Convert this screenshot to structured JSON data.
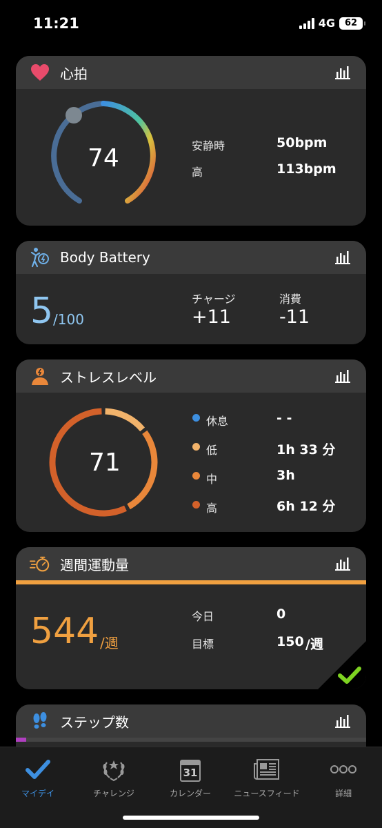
{
  "status_bar": {
    "time": "11:21",
    "network": "4G",
    "battery": "62"
  },
  "colors": {
    "accent_blue": "#3d8fe0",
    "weekly_orange": "#f0a040",
    "check_green": "#7ed321",
    "steps_purple": "#b03fc0"
  },
  "heart_rate": {
    "title": "心拍",
    "icon": "heart-icon",
    "current": "74",
    "current_fraction": 0.05,
    "rows": [
      {
        "label": "安静時",
        "value": "50bpm"
      },
      {
        "label": "高",
        "value": "113bpm"
      }
    ]
  },
  "body_battery": {
    "title": "Body Battery",
    "icon": "body-battery-icon",
    "level": "5",
    "max": "/100",
    "charge_label": "チャージ",
    "charge_value": "+11",
    "drain_label": "消費",
    "drain_value": "-11"
  },
  "stress": {
    "title": "ストレスレベル",
    "icon": "stress-person-icon",
    "level": "71",
    "rows": [
      {
        "label": "休息",
        "value": "- -",
        "color": "#3d8fe0"
      },
      {
        "label": "低",
        "value": "1h 33 分",
        "color": "#f2b36b"
      },
      {
        "label": "中",
        "value": "3h",
        "color": "#e9873a"
      },
      {
        "label": "高",
        "value": "6h 12 分",
        "color": "#d3612a"
      }
    ],
    "segments": [
      {
        "name": "low",
        "minutes": 93,
        "color": "#f2b36b"
      },
      {
        "name": "medium",
        "minutes": 180,
        "color": "#e9873a"
      },
      {
        "name": "high",
        "minutes": 372,
        "color": "#d3612a"
      }
    ]
  },
  "weekly_activity": {
    "title": "週間運動量",
    "icon": "stopwatch-icon",
    "value": "544",
    "unit": "/週",
    "today_label": "今日",
    "today_value": "0",
    "goal_label": "目標",
    "goal_value": "150",
    "goal_unit": "/週",
    "badge_icon": "check-icon"
  },
  "steps": {
    "title": "ステップ数",
    "icon": "footsteps-icon"
  },
  "tabs": [
    {
      "label": "マイデイ",
      "icon": "check-icon",
      "active": true
    },
    {
      "label": "チャレンジ",
      "icon": "laurel-icon",
      "active": false
    },
    {
      "label": "カレンダー",
      "icon": "calendar-icon",
      "day": "31",
      "active": false
    },
    {
      "label": "ニュースフィード",
      "icon": "newspaper-icon",
      "active": false
    },
    {
      "label": "詳細",
      "icon": "more-dots-icon",
      "active": false
    }
  ]
}
